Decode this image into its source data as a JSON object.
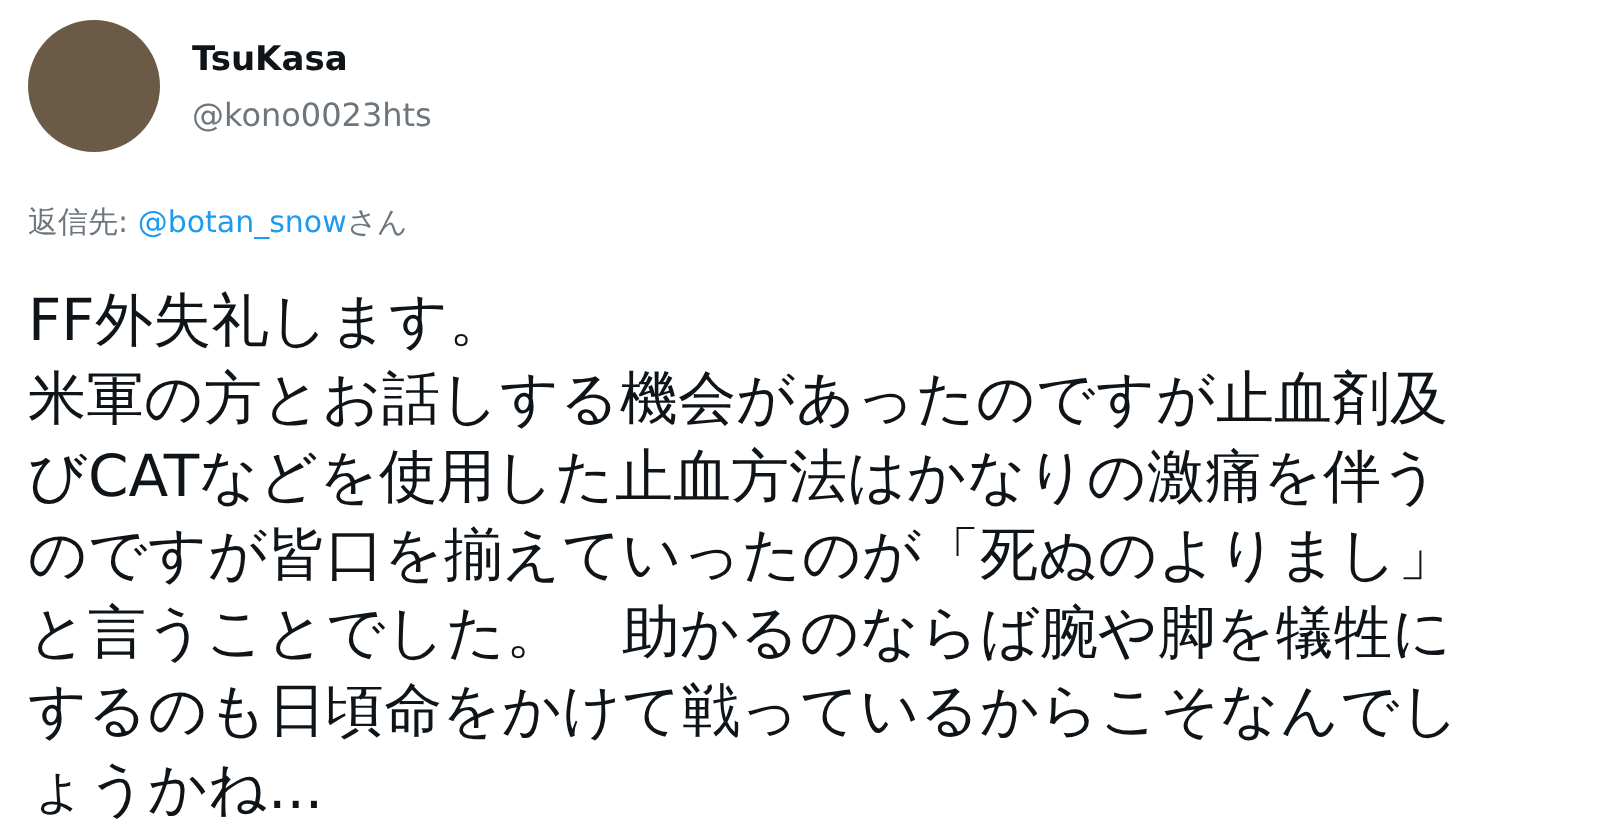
{
  "author": {
    "name": "TsuKasa",
    "handle": "@kono0023hts"
  },
  "reply_to": {
    "prefix": "返信先: ",
    "mention": "@botan_snow",
    "suffix": "さん"
  },
  "body_lines": [
    "FF外失礼します。",
    "米軍の方とお話しする機会があったのですが止血剤及",
    "びCATなどを使用した止血方法はかなりの激痛を伴う",
    "のですが皆口を揃えていったのが「死ぬのよりまし」",
    "と言うことでした。　助かるのならば腕や脚を犠牲に",
    "するのも日頃命をかけて戦っているからこそなんでし",
    "ょうかね..."
  ]
}
